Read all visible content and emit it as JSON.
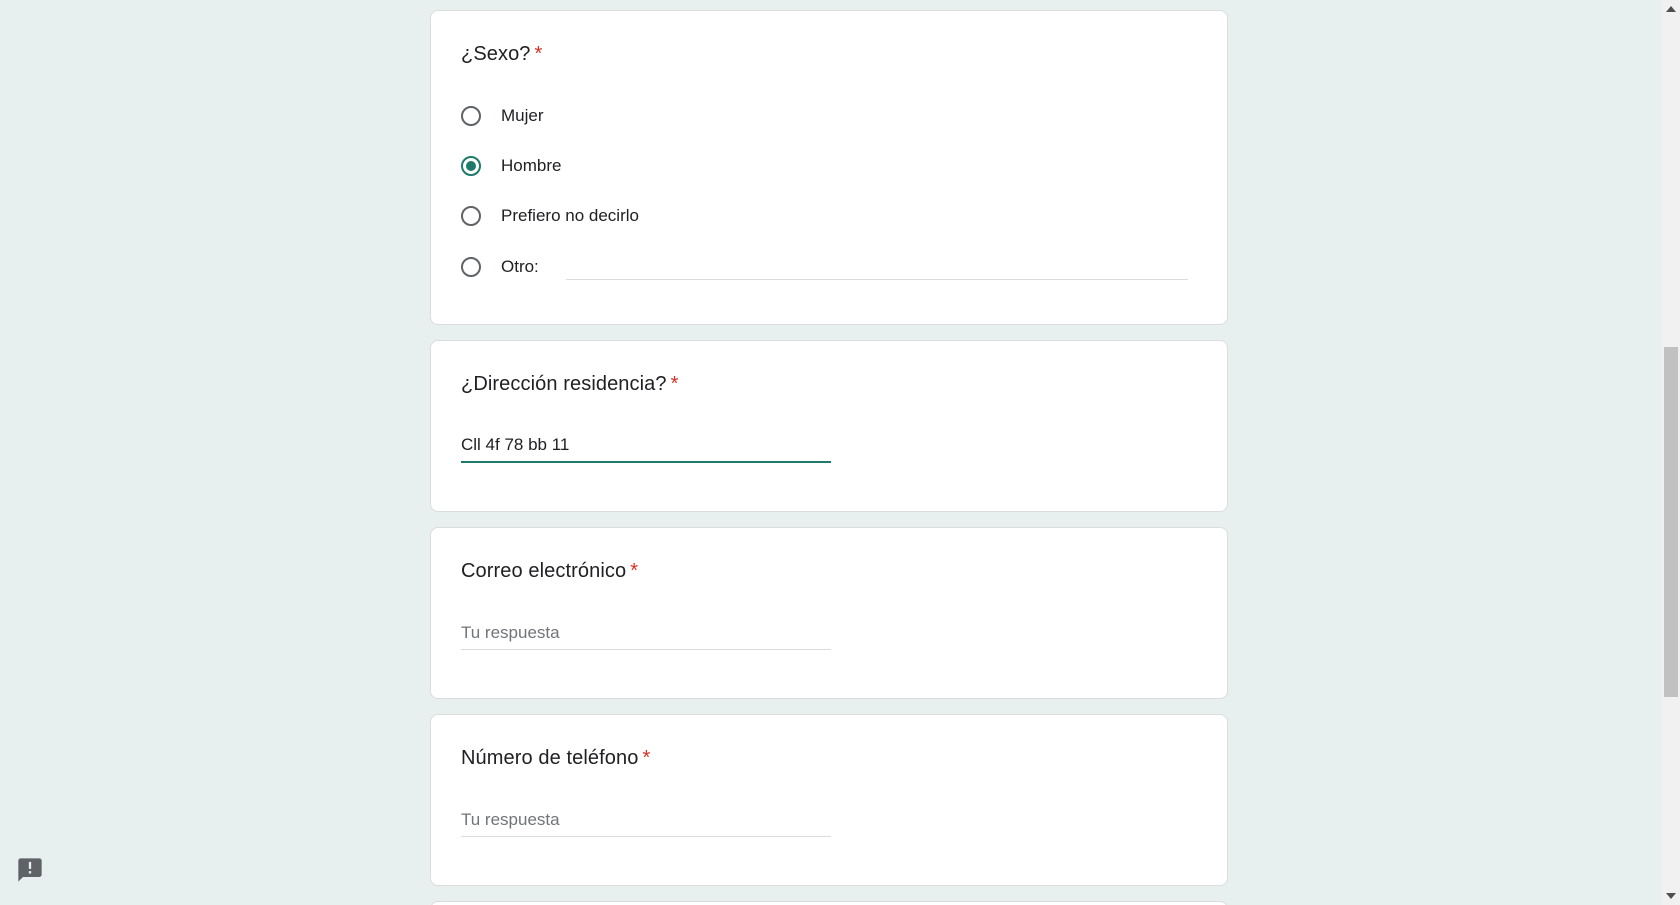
{
  "form": {
    "sexo": {
      "title": "¿Sexo?",
      "required_marker": "*",
      "options": [
        {
          "label": "Mujer",
          "checked": false
        },
        {
          "label": "Hombre",
          "checked": true
        },
        {
          "label": "Prefiero no decirlo",
          "checked": false
        },
        {
          "label": "Otro:",
          "checked": false
        }
      ]
    },
    "direccion": {
      "title": "¿Dirección residencia?",
      "required_marker": "*",
      "value": "Cll 4f 78 bb 11"
    },
    "correo": {
      "title": "Correo electrónico",
      "required_marker": "*",
      "placeholder": "Tu respuesta"
    },
    "telefono": {
      "title": "Número de teléfono",
      "required_marker": "*",
      "placeholder": "Tu respuesta"
    }
  },
  "icons": {
    "feedback": "report-feedback-icon"
  },
  "colors": {
    "accent": "#1e7a6b",
    "required": "#d93025",
    "background": "#e8f0ef"
  }
}
